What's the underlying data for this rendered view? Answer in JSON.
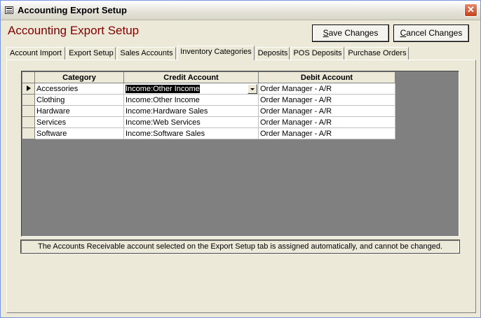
{
  "window": {
    "title": "Accounting Export Setup"
  },
  "header": {
    "title": "Accounting Export Setup"
  },
  "buttons": {
    "save": {
      "underline": "S",
      "rest": "ave Changes"
    },
    "cancel": {
      "underline": "C",
      "rest": "ancel Changes"
    }
  },
  "tabs": [
    {
      "label": "Account Import"
    },
    {
      "label": "Export Setup"
    },
    {
      "label": "Sales Accounts"
    },
    {
      "label": "Inventory Categories"
    },
    {
      "label": "Deposits"
    },
    {
      "label": "POS Deposits"
    },
    {
      "label": "Purchase Orders"
    }
  ],
  "grid": {
    "columns": [
      "Category",
      "Credit Account",
      "Debit Account"
    ],
    "rows": [
      {
        "category": "Accessories",
        "credit": "Income:Other Income",
        "debit": "Order Manager - A/R"
      },
      {
        "category": "Clothing",
        "credit": "Income:Other Income",
        "debit": "Order Manager - A/R"
      },
      {
        "category": "Hardware",
        "credit": "Income:Hardware Sales",
        "debit": "Order Manager - A/R"
      },
      {
        "category": "Services",
        "credit": "Income:Web Services",
        "debit": "Order Manager - A/R"
      },
      {
        "category": "Software",
        "credit": "Income:Software Sales",
        "debit": "Order Manager - A/R"
      }
    ]
  },
  "note": "The Accounts Receivable account selected on the Export Setup tab is assigned automatically, and cannot be changed."
}
